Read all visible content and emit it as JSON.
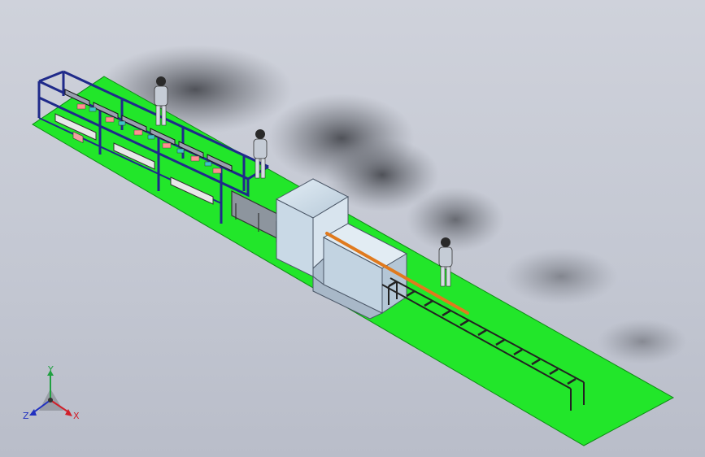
{
  "viewport": {
    "background": "#c7cbd6"
  },
  "scene": {
    "floor_color": "#22e62a",
    "frame_color": "#1f2a8a",
    "machine_color": "#c9d9e6",
    "bar_color": "#e07a1e",
    "roller_color": "#2a2a2a",
    "operator_count": 3
  },
  "triad": {
    "x_label": "X",
    "y_label": "Y",
    "z_label": "Z",
    "x_color": "#d0202a",
    "y_color": "#20a040",
    "z_color": "#2030c0"
  }
}
